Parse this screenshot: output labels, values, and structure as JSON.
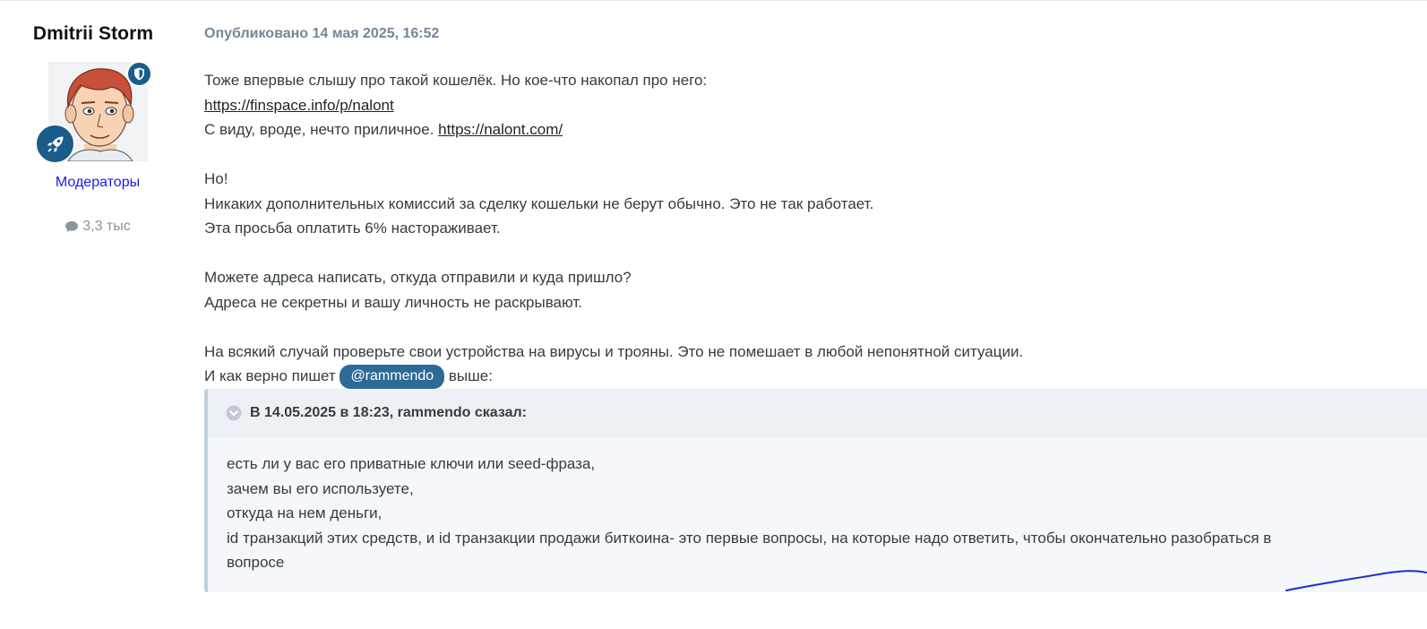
{
  "author": {
    "name": "Dmitrii Storm",
    "group": "Модераторы",
    "posts_count": "3,3 тыс",
    "icons": [
      "shield-icon",
      "rocket-icon",
      "comment-icon"
    ]
  },
  "post": {
    "published": "Опубликовано 14 мая 2025, 16:52",
    "p1": "Тоже впервые слышу про такой кошелёк. Но кое-что накопал про него:",
    "link1": "https://finspace.info/p/nalont",
    "p3_text": "С виду, вроде, нечто приличное.",
    "link2": "https://nalont.com/",
    "p4": "Но!",
    "p5": "Никаких дополнительных комиссий за сделку кошельки не берут обычно. Это не так работает.",
    "p6": "Эта просьба оплатить 6% настораживает.",
    "p7": "Можете адреса написать, откуда отправили и куда пришло?",
    "p8": "Адреса не секретны и вашу личность не раскрывают.",
    "p9": "На всякий случай проверьте свои устройства на вирусы и трояны. Это не помешает в любой непонятной ситуации.",
    "p10_before": "И как верно пишет",
    "mention": "@rammendo",
    "p10_after": "выше:"
  },
  "quote": {
    "header": "В 14.05.2025 в 18:23, rammendo сказал:",
    "lines": [
      "есть ли у вас его приватные ключи или seed-фраза,",
      "зачем вы его используете,",
      "откуда на нем деньги,",
      "id транзакций этих средств, и id транзакции продажи биткоина- это первые вопросы, на которые надо ответить, чтобы окончательно разобраться в",
      "вопросе"
    ]
  },
  "colors": {
    "accent": "#1a5c8a",
    "mention_bg": "#2d6a96",
    "group_link": "#1a1aee",
    "date": "#76859a",
    "quote_bg": "#f5f7fa",
    "quote_head_bg": "#edf1f6"
  }
}
